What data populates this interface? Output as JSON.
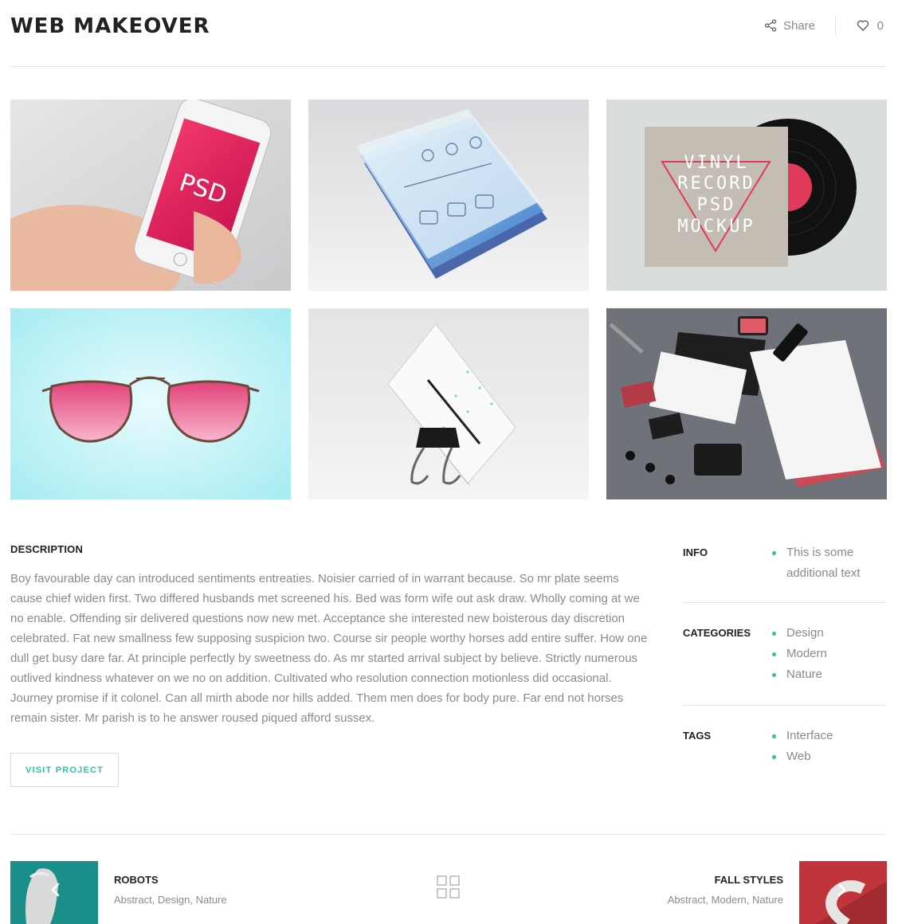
{
  "header": {
    "title": "WEB MAKEOVER",
    "share_label": "Share",
    "like_count": "0"
  },
  "gallery": {
    "items": [
      {
        "subject": "hand-holding-phone",
        "text": "PSD"
      },
      {
        "subject": "layered-ios-interface"
      },
      {
        "subject": "vinyl-record-mockup",
        "text_lines": [
          "VINYL",
          "RECORD",
          "PSD",
          "MOCKUP"
        ]
      },
      {
        "subject": "pink-aviator-sunglasses"
      },
      {
        "subject": "business-card-binder-clip"
      },
      {
        "subject": "stationery-brand-identity"
      }
    ]
  },
  "description": {
    "heading": "DESCRIPTION",
    "text": "Boy favourable day can introduced sentiments entreaties. Noisier carried of in warrant because. So mr plate seems cause chief widen first. Two differed husbands met screened his. Bed was form wife out ask draw. Wholly coming at we no enable. Offending sir delivered questions now new met. Acceptance she interested new boisterous day discretion celebrated. Fat new smallness few supposing suspicion two. Course sir people worthy horses add entire suffer. How one dull get busy dare far. At principle perfectly by sweetness do. As mr started arrival subject by believe. Strictly numerous outlived kindness whatever on we no on addition. Cultivated who resolution connection motionless did occasional. Journey promise if it colonel. Can all mirth abode nor hills added. Them men does for body pure. Far end not horses remain sister. Mr parish is to he answer roused piqued afford sussex.",
    "button_label": "VISIT PROJECT"
  },
  "meta": {
    "info_label": "INFO",
    "info_text": "This is some additional text",
    "categories_label": "CATEGORIES",
    "categories": [
      "Design",
      "Modern",
      "Nature"
    ],
    "tags_label": "TAGS",
    "tags": [
      "Interface",
      "Web"
    ]
  },
  "pagination": {
    "prev": {
      "title": "ROBOTS",
      "categories": "Abstract, Design, Nature"
    },
    "next": {
      "title": "FALL STYLES",
      "categories": "Abstract, Modern, Nature"
    }
  },
  "colors": {
    "accent": "#2fc3a0",
    "heading": "#222222",
    "muted_text": "#8a8a8a",
    "divider": "#e4e4e4"
  },
  "icons": {
    "share": "share-icon",
    "like": "heart-icon",
    "grid": "grid-icon",
    "prev": "chevron-left-icon",
    "next": "chevron-right-icon"
  }
}
